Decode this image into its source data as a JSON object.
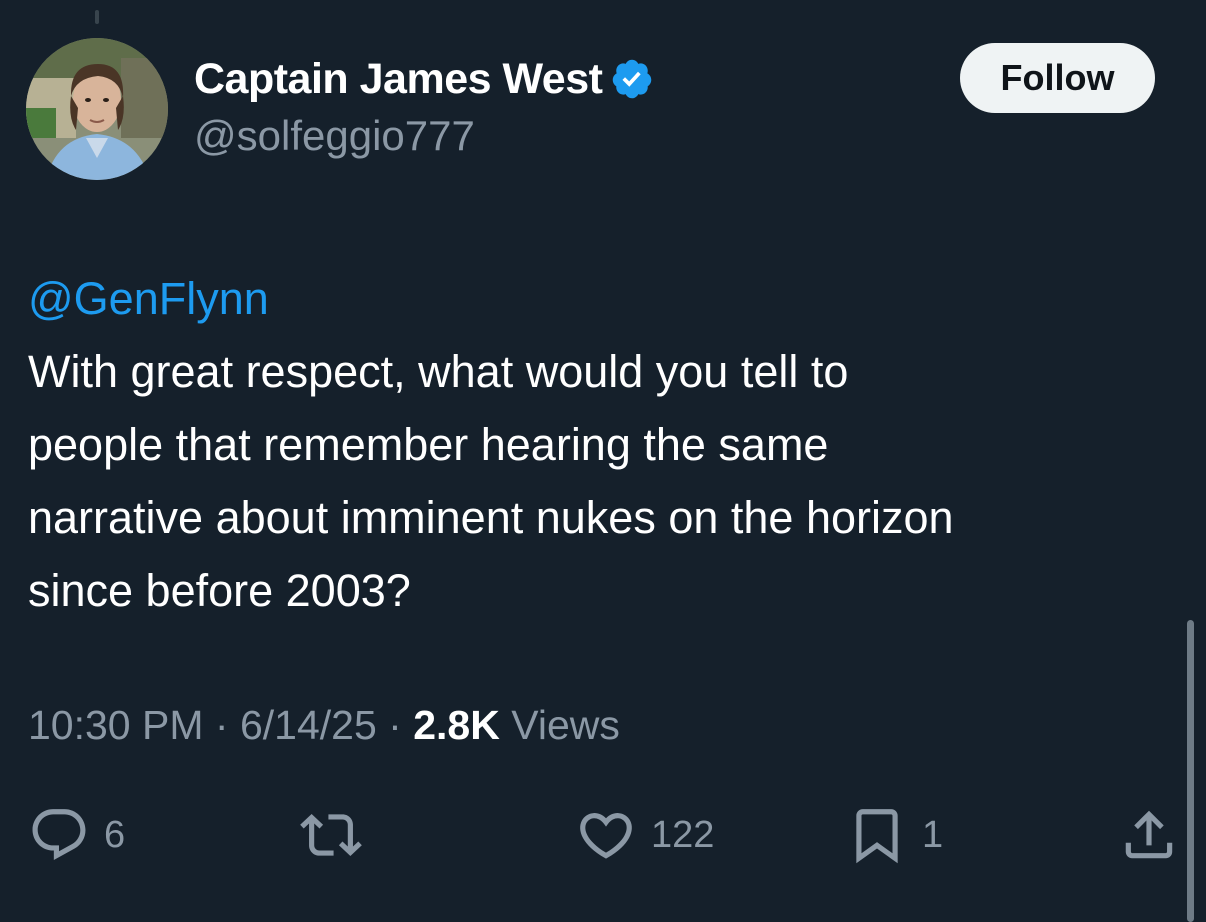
{
  "author": {
    "display_name": "Captain James West",
    "handle": "@solfeggio777",
    "verified": true
  },
  "follow_label": "Follow",
  "tweet": {
    "mention": "@GenFlynn",
    "lines": [
      "With great respect, what would you tell to",
      "people that remember hearing the same",
      "narrative about imminent nukes on the horizon",
      "since before 2003?"
    ]
  },
  "meta": {
    "time": "10:30 PM",
    "separator": "·",
    "date": "6/14/25",
    "views_count": "2.8K",
    "views_label": "Views"
  },
  "actions": {
    "replies": "6",
    "likes": "122",
    "bookmarks": "1"
  },
  "colors": {
    "background": "#15202b",
    "accent": "#1d9bf0",
    "muted": "#8b98a5"
  }
}
